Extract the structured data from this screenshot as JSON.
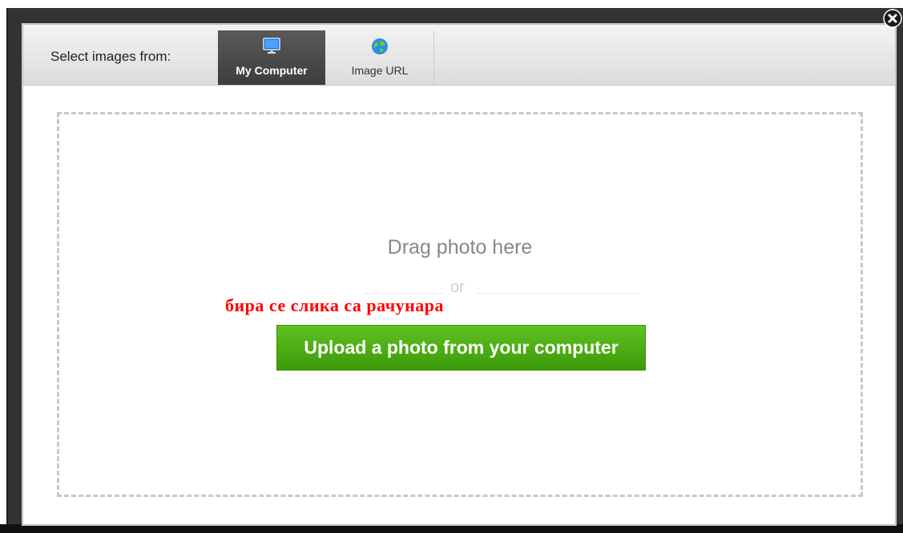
{
  "toolbar": {
    "label": "Select images from:",
    "tabs": [
      {
        "label": "My Computer",
        "icon": "monitor-icon",
        "selected": true
      },
      {
        "label": "Image URL",
        "icon": "globe-icon",
        "selected": false
      }
    ]
  },
  "dropzone": {
    "drag_text": "Drag photo here",
    "or_text": "or",
    "annotation": "бира се слика са рачунара",
    "upload_button": "Upload a photo from your computer"
  },
  "colors": {
    "upload_button": "#4caf1a",
    "annotation": "#ff0000",
    "selected_tab": "#4a4a4a"
  },
  "close_icon": "close-circle-icon"
}
